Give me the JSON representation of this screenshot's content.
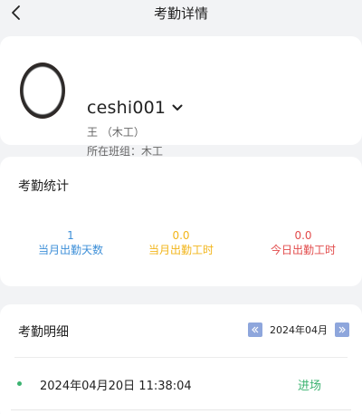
{
  "header": {
    "title": "考勤详情"
  },
  "profile": {
    "name": "ceshi001",
    "role_line": "王 （木工）",
    "team_line": "所在班组：木工"
  },
  "stats": {
    "title": "考勤统计",
    "items": [
      {
        "value": "1",
        "label": "当月出勤天数",
        "color": "#3d8fd8"
      },
      {
        "value": "0.0",
        "label": "当月出勤工时",
        "color": "#f2b51a"
      },
      {
        "value": "0.0",
        "label": "今日出勤工时",
        "color": "#e24b4b"
      }
    ]
  },
  "detail": {
    "title": "考勤明细",
    "month": "2024年04月",
    "records": [
      {
        "time": "2024年04月20日 11:38:04",
        "type": "进场"
      }
    ]
  }
}
